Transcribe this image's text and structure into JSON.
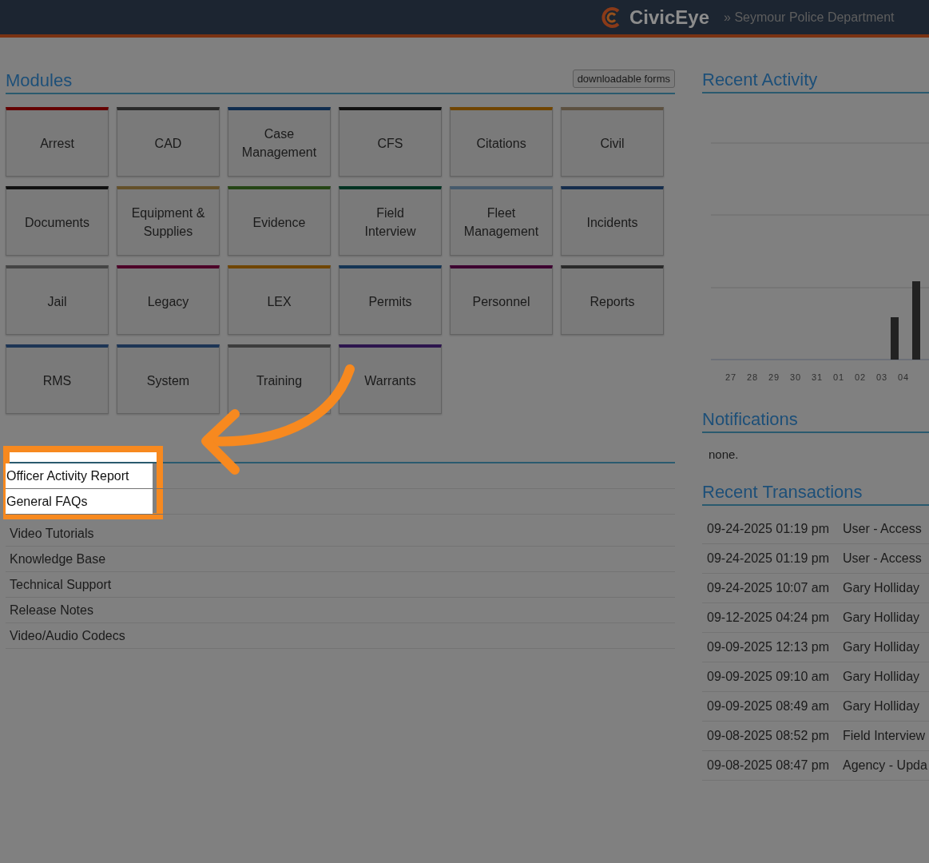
{
  "header": {
    "brand": "CivicEye",
    "breadcrumb": "» Seymour Police Department"
  },
  "modules": {
    "title": "Modules",
    "forms_button": "downloadable forms",
    "tiles": [
      {
        "label": "Arrest",
        "color": "#640000"
      },
      {
        "label": "CAD",
        "color": "#2a2a2a"
      },
      {
        "label": "Case Management",
        "color": "#102d4e"
      },
      {
        "label": "CFS",
        "color": "#111111"
      },
      {
        "label": "Citations",
        "color": "#704500"
      },
      {
        "label": "Civil",
        "color": "#5c5040"
      },
      {
        "label": "Documents",
        "color": "#111111"
      },
      {
        "label": "Equipment & Supplies",
        "color": "#64502a"
      },
      {
        "label": "Evidence",
        "color": "#254515"
      },
      {
        "label": "Field Interview",
        "color": "#003322"
      },
      {
        "label": "Fleet Management",
        "color": "#455a6c"
      },
      {
        "label": "Incidents",
        "color": "#152d4d"
      },
      {
        "label": "Jail",
        "color": "#444444"
      },
      {
        "label": "Legacy",
        "color": "#4d0028"
      },
      {
        "label": "LEX",
        "color": "#704500"
      },
      {
        "label": "Permits",
        "color": "#153555"
      },
      {
        "label": "Personnel",
        "color": "#3d0030"
      },
      {
        "label": "Reports",
        "color": "#2a2a2a"
      },
      {
        "label": "RMS",
        "color": "#1d3555"
      },
      {
        "label": "System",
        "color": "#1d3555"
      },
      {
        "label": "Training",
        "color": "#3c3c3c"
      },
      {
        "label": "Warrants",
        "color": "#2d154d"
      }
    ]
  },
  "helpful_resources": {
    "links": [
      {
        "label": "Officer Activity Report",
        "highlighted": true
      },
      {
        "label": "General FAQs",
        "highlighted": true
      },
      {
        "label": "Video Tutorials",
        "highlighted": false
      },
      {
        "label": "Knowledge Base",
        "highlighted": false
      },
      {
        "label": "Technical Support",
        "highlighted": false
      },
      {
        "label": "Release Notes",
        "highlighted": false
      },
      {
        "label": "Video/Audio Codecs",
        "highlighted": false
      }
    ]
  },
  "recent_activity": {
    "title": "Recent Activity",
    "axis_labels": [
      "27",
      "28",
      "29",
      "30",
      "31",
      "01",
      "02",
      "03",
      "04"
    ]
  },
  "notifications": {
    "title": "Notifications",
    "text": "none."
  },
  "recent_transactions": {
    "title": "Recent Transactions",
    "rows": [
      {
        "time": "09-24-2025 01:19 pm",
        "description": "User - Access"
      },
      {
        "time": "09-24-2025 01:19 pm",
        "description": "User - Access"
      },
      {
        "time": "09-24-2025 10:07 am",
        "description": "Gary Holliday"
      },
      {
        "time": "09-12-2025 04:24 pm",
        "description": "Gary Holliday"
      },
      {
        "time": "09-09-2025 12:13 pm",
        "description": "Gary Holliday"
      },
      {
        "time": "09-09-2025 09:10 am",
        "description": "Gary Holliday"
      },
      {
        "time": "09-09-2025 08:49 am",
        "description": "Gary Holliday"
      },
      {
        "time": "09-08-2025 08:52 pm",
        "description": "Field Interview"
      },
      {
        "time": "09-08-2025 08:47 pm",
        "description": "Agency - Upda"
      }
    ]
  }
}
